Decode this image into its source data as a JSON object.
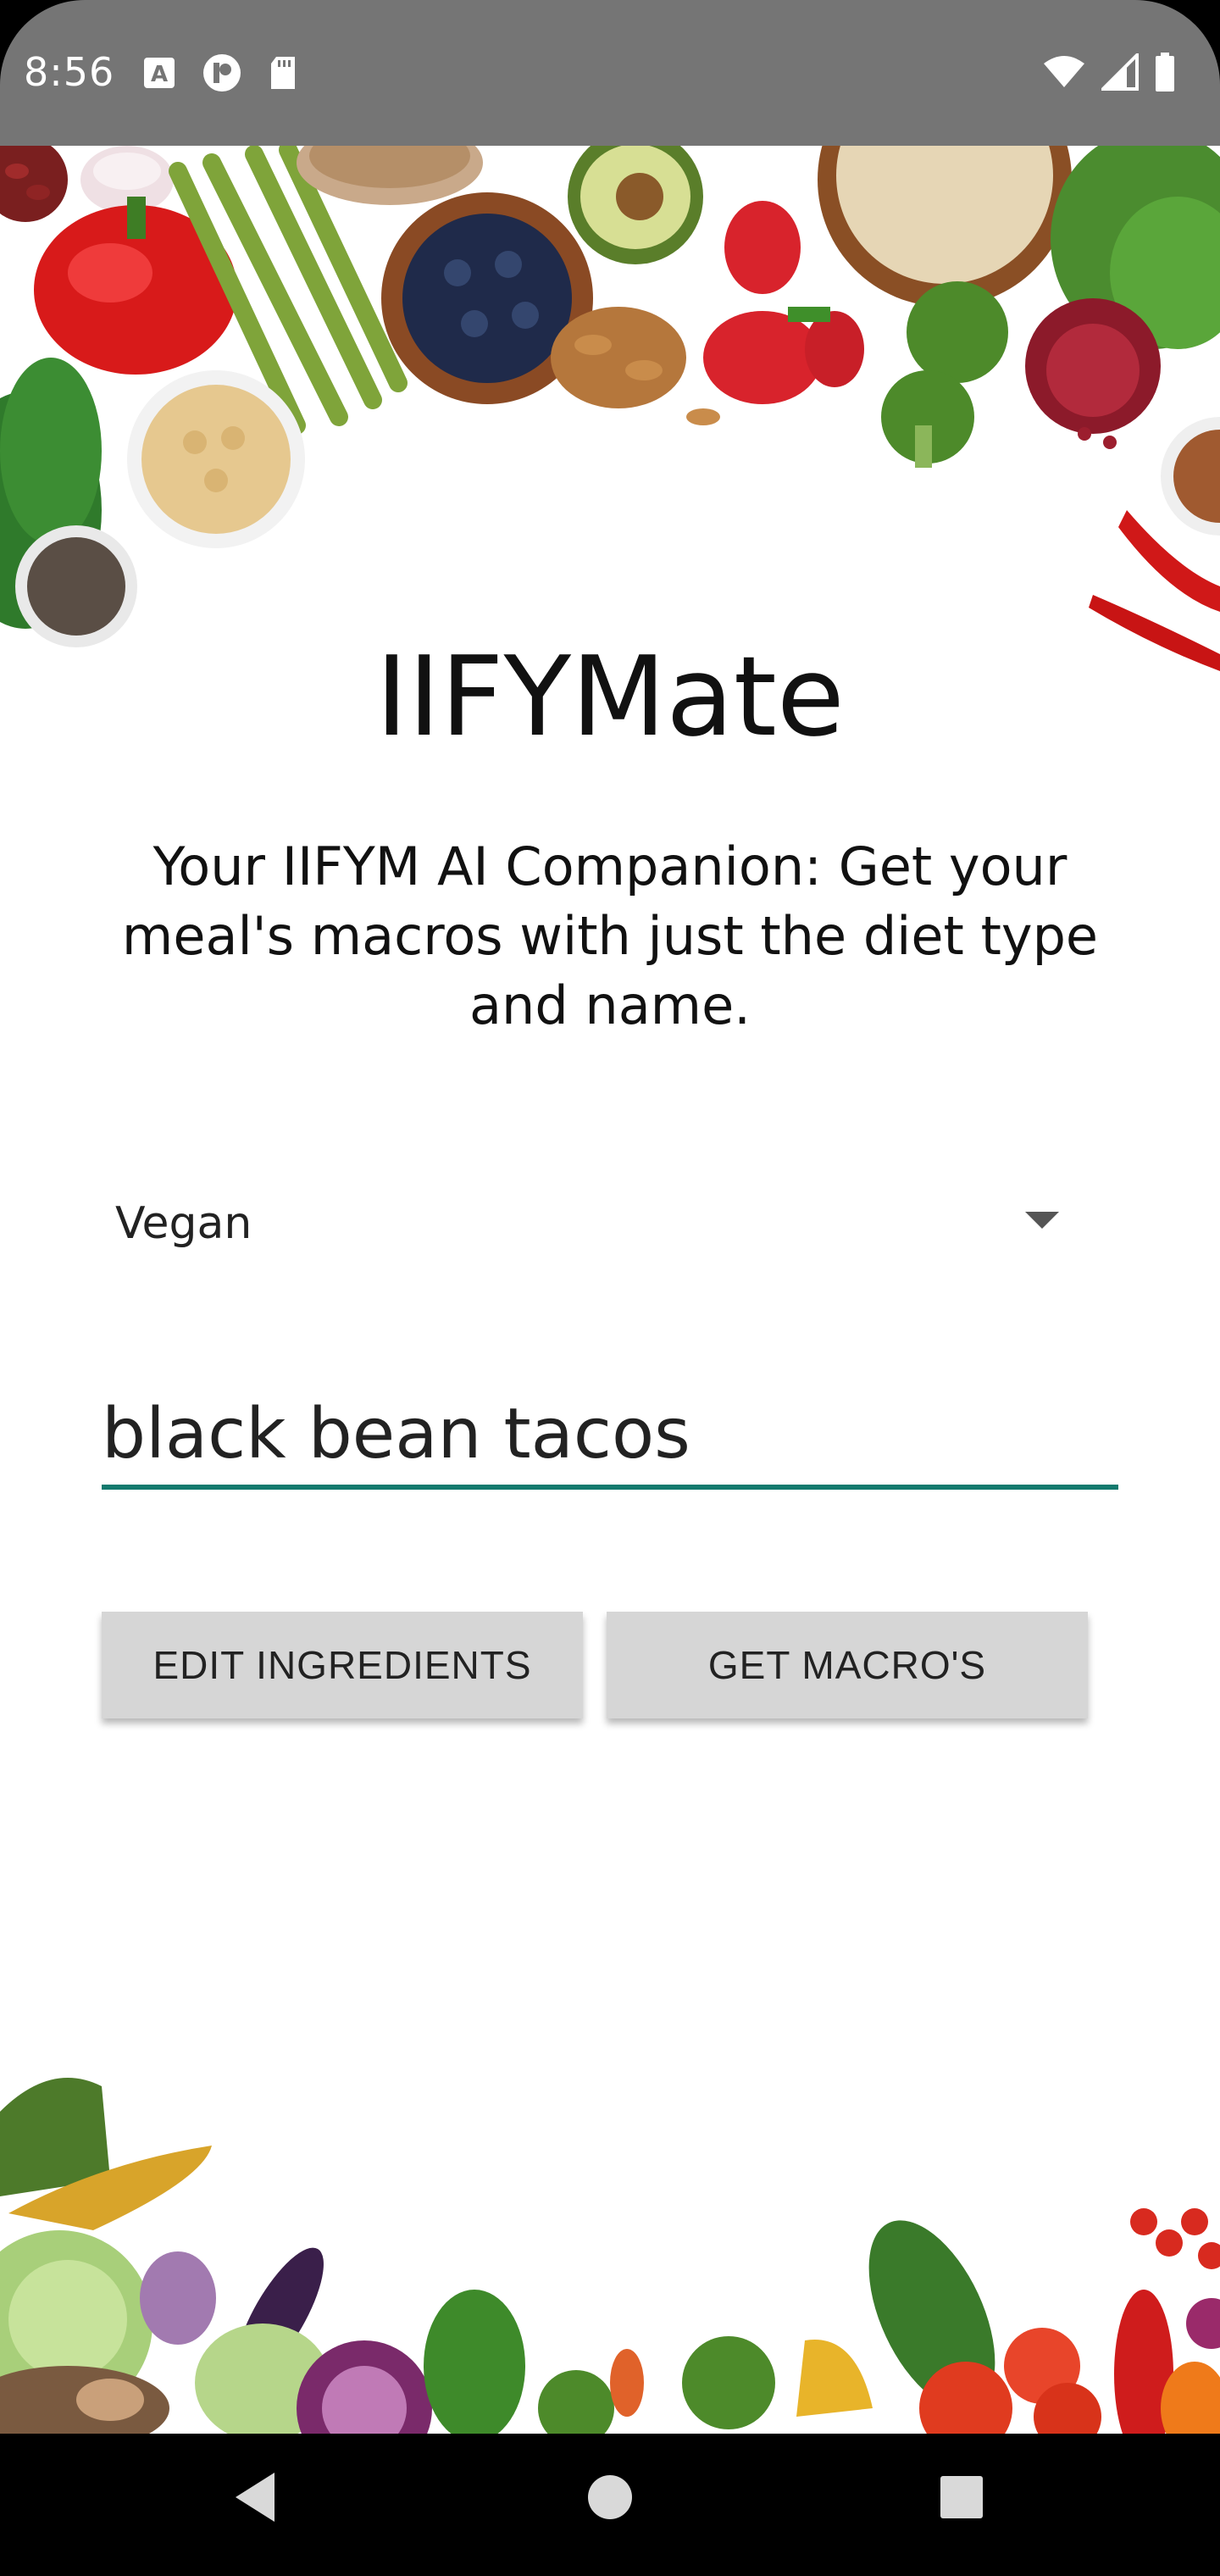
{
  "status_bar": {
    "time": "8:56",
    "left_icons": [
      "a-badge-icon",
      "circle-p-icon",
      "sd-card-icon"
    ],
    "right_icons": [
      "wifi-icon",
      "signal-icon",
      "battery-icon"
    ],
    "background": "#757575"
  },
  "app": {
    "title": "IIFYMate",
    "subtitle": "Your IIFYM AI Companion: Get your meal's macros with just the diet type and name."
  },
  "diet_spinner": {
    "selected": "Vegan"
  },
  "meal_input": {
    "value": "black bean tacos",
    "underline_color": "#137a6e"
  },
  "buttons": {
    "edit_ingredients": "EDIT INGREDIENTS",
    "get_macros": "GET MACRO'S",
    "background": "#d6d6d6"
  },
  "nav_bar": {
    "icons": [
      "back-icon",
      "home-icon",
      "recents-icon"
    ]
  }
}
